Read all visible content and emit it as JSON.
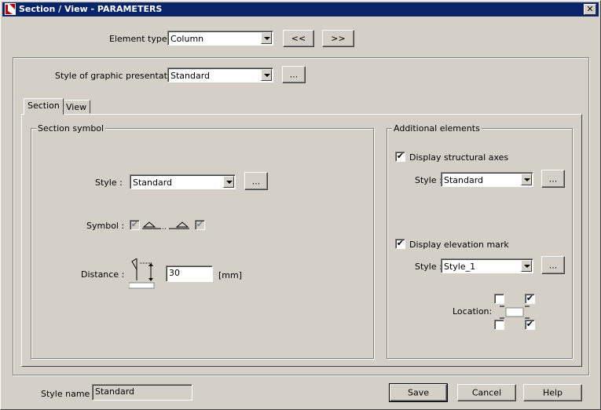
{
  "window": {
    "title": "Section / View - PARAMETERS",
    "close_glyph": "✕"
  },
  "header": {
    "element_type_label": "Element type :",
    "element_type_value": "Column",
    "prev_label": "<<",
    "next_label": ">>"
  },
  "presentation": {
    "label": "Style of graphic presentation:",
    "value": "Standard",
    "more_label": "..."
  },
  "tabs": [
    {
      "label": "Section",
      "active": true
    },
    {
      "label": "View",
      "active": false
    }
  ],
  "section_symbol": {
    "legend": "Section symbol",
    "style_label": "Style :",
    "style_value": "Standard",
    "style_more": "...",
    "symbol_label": "Symbol :",
    "symbol_left_checked": true,
    "symbol_right_checked": true,
    "distance_label": "Distance :",
    "distance_value": "30",
    "distance_unit": "[mm]"
  },
  "additional": {
    "legend": "Additional elements",
    "axes_label": "Display structural axes",
    "axes_checked": true,
    "axes_style_label": "Style :",
    "axes_style_value": "Standard",
    "axes_more": "...",
    "elev_label": "Display elevation mark",
    "elev_checked": true,
    "elev_style_label": "Style :",
    "elev_style_value": "Style_1",
    "elev_more": "...",
    "location_label": "Location:",
    "location": {
      "top_left": false,
      "top_right": true,
      "bottom_left": false,
      "bottom_right": true
    }
  },
  "footer": {
    "style_name_label": "Style name :",
    "style_name_value": "Standard",
    "save_label": "Save",
    "cancel_label": "Cancel",
    "help_label": "Help"
  },
  "check_glyph": "✔"
}
